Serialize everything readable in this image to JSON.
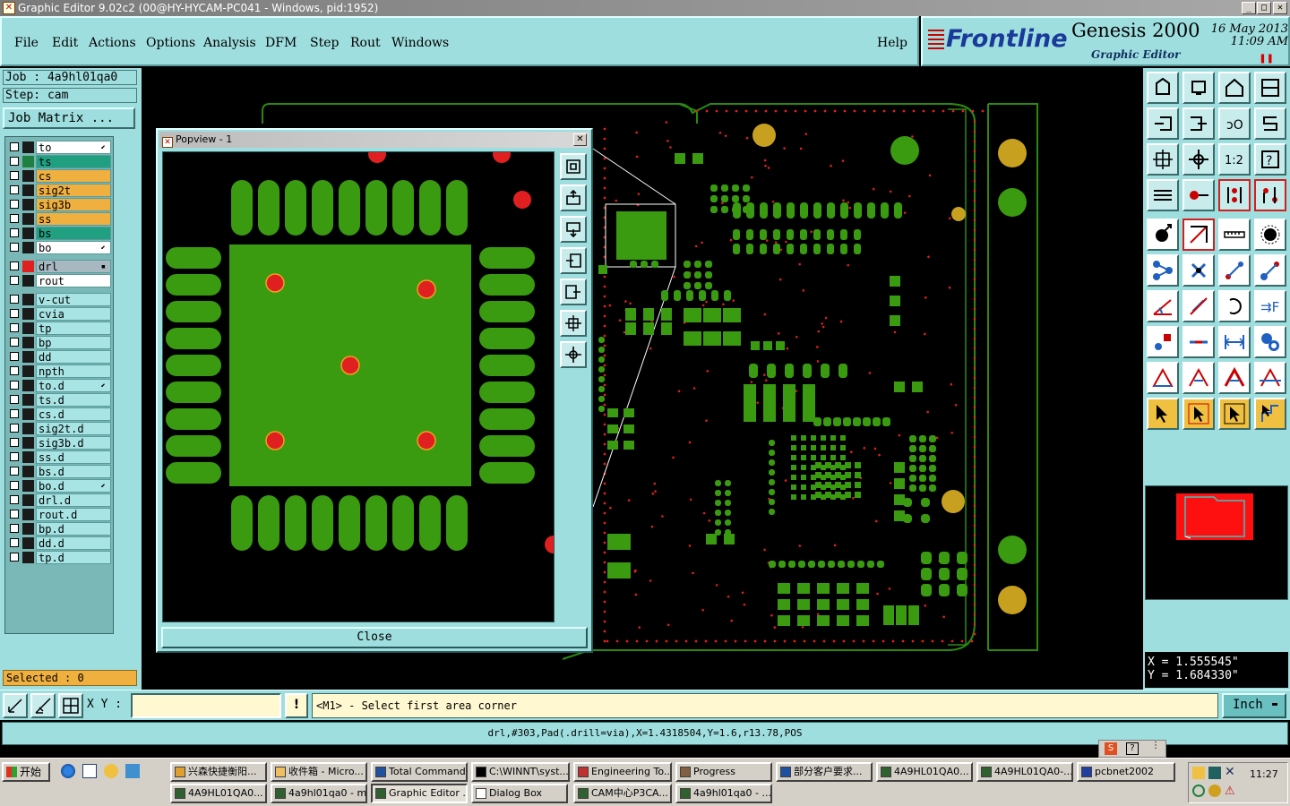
{
  "window": {
    "title": "Graphic Editor 9.02c2 (00@HY-HYCAM-PC041 - Windows, pid:1952)"
  },
  "menu": {
    "items": [
      "File",
      "Edit",
      "Actions",
      "Options",
      "Analysis",
      "DFM",
      "Step",
      "Rout",
      "Windows"
    ],
    "help": "Help"
  },
  "brand": {
    "logo": "Frontline",
    "product": "Genesis 2000",
    "subtitle": "Graphic Editor",
    "date": "16 May 2013",
    "time": "11:09 AM"
  },
  "job": {
    "job_label": "Job : 4a9hl01qa0",
    "step_label": "Step: cam",
    "matrix_button": "Job Matrix ..."
  },
  "layers": {
    "board": [
      {
        "name": "to",
        "color": "#ffffff",
        "mark": "⬋",
        "side": "#1a1a1a"
      },
      {
        "name": "ts",
        "color": "#20a080",
        "mark": "",
        "side": "#208040"
      },
      {
        "name": "cs",
        "color": "#f0b040",
        "mark": "",
        "side": "#1a1a1a"
      },
      {
        "name": "sig2t",
        "color": "#f0b040",
        "mark": "",
        "side": "#1a1a1a"
      },
      {
        "name": "sig3b",
        "color": "#f0b040",
        "mark": "",
        "side": "#1a1a1a"
      },
      {
        "name": "ss",
        "color": "#f0b040",
        "mark": "",
        "side": "#1a1a1a"
      },
      {
        "name": "bs",
        "color": "#20a080",
        "mark": "",
        "side": "#1a1a1a"
      },
      {
        "name": "bo",
        "color": "#ffffff",
        "mark": "⬋",
        "side": "#1a1a1a"
      }
    ],
    "drill": [
      {
        "name": "drl",
        "color": "#a8b8c0",
        "mark": "▪",
        "side": "#e02020"
      },
      {
        "name": "rout",
        "color": "#ffffff",
        "mark": "",
        "side": "#1a1a1a"
      }
    ],
    "docs": [
      {
        "name": "v-cut",
        "mark": ""
      },
      {
        "name": "cvia",
        "mark": ""
      },
      {
        "name": "tp",
        "mark": ""
      },
      {
        "name": "bp",
        "mark": ""
      },
      {
        "name": "dd",
        "mark": ""
      },
      {
        "name": "npth",
        "mark": ""
      },
      {
        "name": "to.d",
        "mark": "⬋"
      },
      {
        "name": "ts.d",
        "mark": ""
      },
      {
        "name": "cs.d",
        "mark": ""
      },
      {
        "name": "sig2t.d",
        "mark": ""
      },
      {
        "name": "sig3b.d",
        "mark": ""
      },
      {
        "name": "ss.d",
        "mark": ""
      },
      {
        "name": "bs.d",
        "mark": ""
      },
      {
        "name": "bo.d",
        "mark": "⬋"
      },
      {
        "name": "drl.d",
        "mark": ""
      },
      {
        "name": "rout.d",
        "mark": ""
      },
      {
        "name": "bp.d",
        "mark": ""
      },
      {
        "name": "dd.d",
        "mark": ""
      },
      {
        "name": "tp.d",
        "mark": ""
      }
    ]
  },
  "selected": "Selected : 0",
  "popview": {
    "title": "Popview - 1",
    "close_label": "Close",
    "close_x": "✕"
  },
  "coords": {
    "x": "X = 1.555545\"",
    "y": "Y = 1.684330\""
  },
  "command": {
    "xy_label": "X Y :",
    "xy_value": "",
    "warn": "!",
    "prompt": "<M1> - Select first area corner",
    "unit": "Inch",
    "unit_arrow": "▬"
  },
  "status": "drl,#303,Pad(.drill=via),X=1.4318504,Y=1.6,r13.78,POS",
  "taskbar": {
    "start": "开始",
    "row1": [
      "兴森快捷衡阳...",
      "收件箱 - Micro...",
      "Total Command...",
      "C:\\WINNT\\syst...",
      "Engineering To...",
      "Progress",
      "部分客户要求...",
      "4A9HL01QA0...",
      "4A9HL01QA0-...",
      "pcbnet2002"
    ],
    "row2": [
      "4A9HL01QA0...",
      "4a9hl01qa0 - m...",
      "Graphic Editor ...",
      "Dialog Box",
      "CAM中心P3CA...",
      "4a9hl01qa0 - ..."
    ],
    "clock": "11:27"
  },
  "colors": {
    "panel": "#9fdede",
    "pad_green": "#3a9a10",
    "drill_red": "#e02020",
    "gold": "#c8a020",
    "outline": "#2a8a10"
  }
}
